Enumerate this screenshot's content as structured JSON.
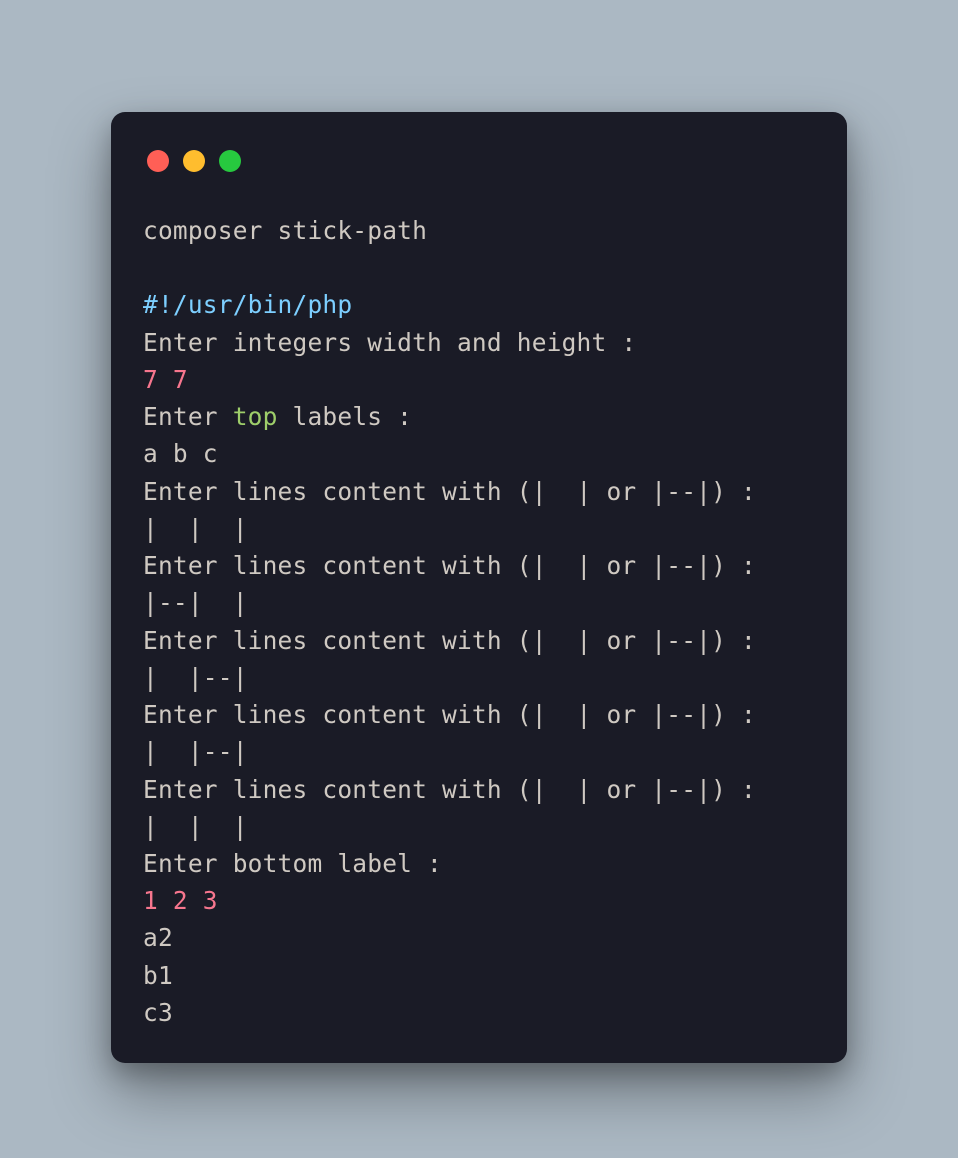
{
  "colors": {
    "background": "#abb8c3",
    "window_bg": "#1a1b26",
    "traffic_red": "#ff5f56",
    "traffic_yellow": "#ffbd2e",
    "traffic_green": "#27c93f",
    "text_default": "#cfc9c2",
    "text_shebang": "#7dcfff",
    "text_number": "#f7768e",
    "text_keyword": "#9ece6a"
  },
  "lines": {
    "l0": "composer stick-path",
    "blank": "",
    "l1": "#!/usr/bin/php",
    "l2": "Enter integers width and height :",
    "l3": "7 7",
    "l4a": "Enter ",
    "l4b": "top",
    "l4c": " labels :",
    "l5": "a b c",
    "lprompt": "Enter lines content with (|  | or |--|) :",
    "l6": "|  |  |",
    "l8": "|--|  |",
    "l10": "|  |--|",
    "l12": "|  |--|",
    "l14": "|  |  |",
    "l15": "Enter bottom label :",
    "l16": "1 2 3",
    "l17": "a2",
    "l18": "b1",
    "l19": "c3"
  }
}
